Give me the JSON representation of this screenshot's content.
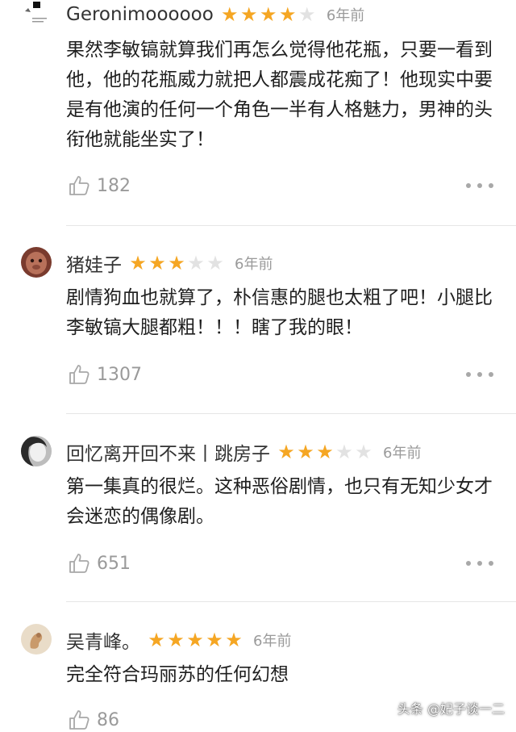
{
  "colors": {
    "star_on": "#f5a623",
    "star_off": "#e2e2e2",
    "meta_gray": "#9a9a9a",
    "text": "#1f1f1f"
  },
  "icons": {
    "like": "thumbs-up-icon",
    "more": "more-dots-icon"
  },
  "reviews": [
    {
      "user": "Geronimoooooo",
      "rating": 4,
      "time": "6年前",
      "text": "果然李敏镐就算我们再怎么觉得他花瓶，只要一看到他，他的花瓶威力就把人都震成花痴了！他现实中要是有他演的任何一个角色一半有人格魅力，男神的头衔他就能坐实了！",
      "likes": "182"
    },
    {
      "user": "猪娃子",
      "rating": 3,
      "time": "6年前",
      "text": "剧情狗血也就算了，朴信惠的腿也太粗了吧！小腿比李敏镐大腿都粗！！！瞎了我的眼！",
      "likes": "1307"
    },
    {
      "user": "回忆离开回不来丨跳房子",
      "rating": 3,
      "time": "6年前",
      "text": "第一集真的很烂。这种恶俗剧情，也只有无知少女才会迷恋的偶像剧。",
      "likes": "651"
    },
    {
      "user": "吴青峰。",
      "rating": 5,
      "time": "6年前",
      "text": "完全符合玛丽苏的任何幻想",
      "likes": "86"
    }
  ],
  "watermark": "头条 @妃子谈一二"
}
